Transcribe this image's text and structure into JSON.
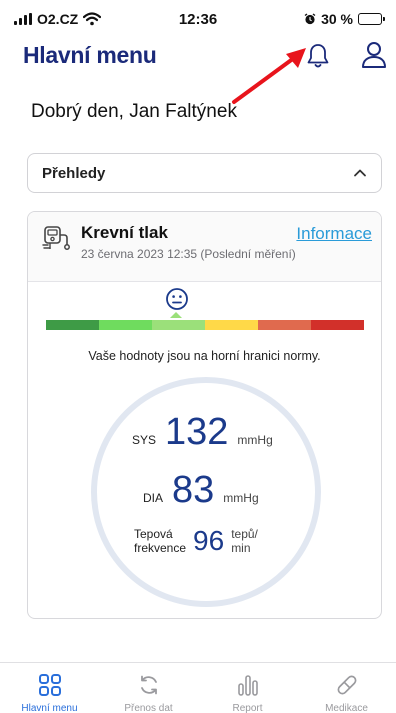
{
  "status_bar": {
    "carrier": "O2.CZ",
    "time": "12:36",
    "battery": "30 %"
  },
  "header": {
    "title": "Hlavní menu"
  },
  "greeting": "Dobrý den, Jan Faltýnek",
  "overview_dropdown": {
    "label": "Přehledy"
  },
  "bp_card": {
    "title": "Krevní tlak",
    "date": "23 června 2023 12:35 (Poslední měření)",
    "info_link": "Informace",
    "scale_colors": [
      "#3e9b46",
      "#6fdc5e",
      "#9be07a",
      "#ffd948",
      "#e06a4e",
      "#d2302a"
    ],
    "scale_level_segment": 3,
    "message": "Vaše hodnoty jsou na horní hranici normy.",
    "sys": {
      "label": "SYS",
      "value": "132",
      "unit": "mmHg"
    },
    "dia": {
      "label": "DIA",
      "value": "83",
      "unit": "mmHg"
    },
    "pulse": {
      "label_line1": "Tepová",
      "label_line2": "frekvence",
      "value": "96",
      "unit_line1": "tepů/",
      "unit_line2": "min"
    }
  },
  "tabbar": {
    "items": [
      {
        "label": "Hlavní menu",
        "icon": "grid-icon",
        "active": true
      },
      {
        "label": "Přenos dat",
        "icon": "sync-icon",
        "active": false
      },
      {
        "label": "Report",
        "icon": "chart-icon",
        "active": false
      },
      {
        "label": "Medikace",
        "icon": "pill-icon",
        "active": false
      }
    ]
  },
  "colors": {
    "title": "#1b2a7a",
    "value": "#1b3a8b",
    "link": "#2a9bd8",
    "active_tab": "#2a6fdb",
    "arrow": "#e8141c"
  }
}
